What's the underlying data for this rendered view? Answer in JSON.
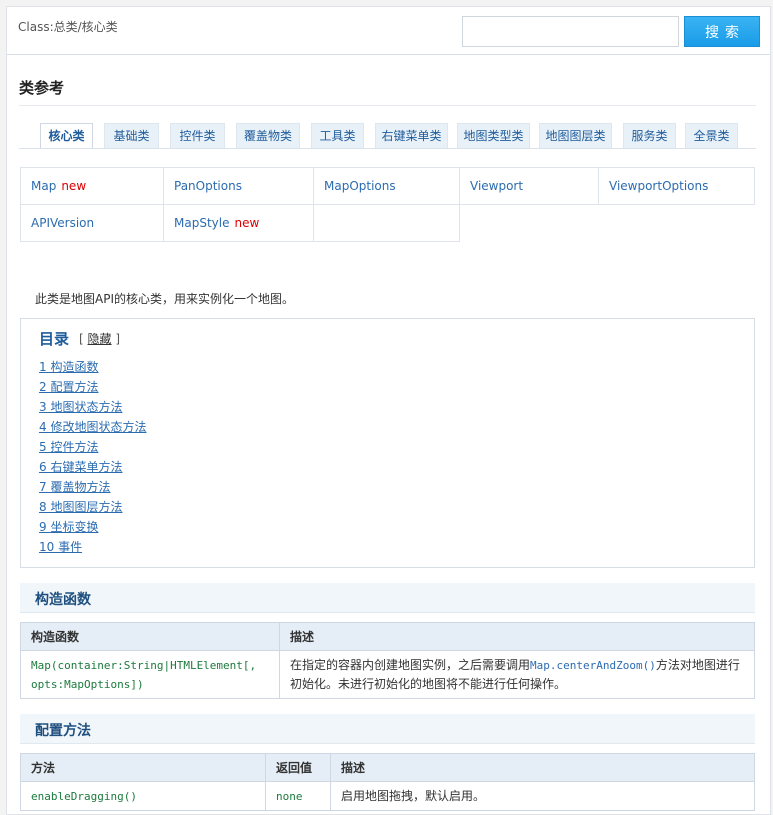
{
  "header": {
    "breadcrumb": "Class:总类/核心类",
    "search_placeholder": "",
    "search_button": "搜索"
  },
  "section_title": "类参考",
  "tabs": [
    {
      "label": "核心类",
      "active": true
    },
    {
      "label": "基础类"
    },
    {
      "label": "控件类"
    },
    {
      "label": "覆盖物类"
    },
    {
      "label": "工具类"
    },
    {
      "label": "右键菜单类"
    },
    {
      "label": "地图类型类"
    },
    {
      "label": "地图图层类"
    },
    {
      "label": "服务类"
    },
    {
      "label": "全景类"
    }
  ],
  "classes": [
    {
      "name": "Map",
      "badge": "new"
    },
    {
      "name": "PanOptions"
    },
    {
      "name": "MapOptions"
    },
    {
      "name": "Viewport"
    },
    {
      "name": "ViewportOptions"
    },
    {
      "name": "APIVersion"
    },
    {
      "name": "MapStyle",
      "badge": "new"
    },
    {
      "name": ""
    }
  ],
  "description": "此类是地图API的核心类，用来实例化一个地图。",
  "toc": {
    "title": "目录",
    "toggle_open": "[",
    "toggle_label": "隐藏",
    "toggle_close": "]",
    "items": [
      "1 构造函数",
      "2 配置方法",
      "3 地图状态方法",
      "4 修改地图状态方法",
      "5 控件方法",
      "6 右键菜单方法",
      "7 覆盖物方法",
      "8 地图图层方法",
      "9 坐标变换",
      "10 事件"
    ]
  },
  "constructor_section": {
    "title": "构造函数",
    "headers": [
      "构造函数",
      "描述"
    ],
    "row": {
      "signature_line1": "Map(container:String|HTMLElement[,",
      "signature_line2": "opts:MapOptions])",
      "desc_part1": "在指定的容器内创建地图实例，之后需要调用",
      "desc_code": "Map.centerAndZoom()",
      "desc_part2": "方法对地图进行初始化。未进行初始化的地图将不能进行任何操作。"
    }
  },
  "config_section": {
    "title": "配置方法",
    "headers": [
      "方法",
      "返回值",
      "描述"
    ],
    "rows": [
      {
        "method": "enableDragging()",
        "returns": "none",
        "desc": "启用地图拖拽，默认启用。"
      }
    ]
  }
}
